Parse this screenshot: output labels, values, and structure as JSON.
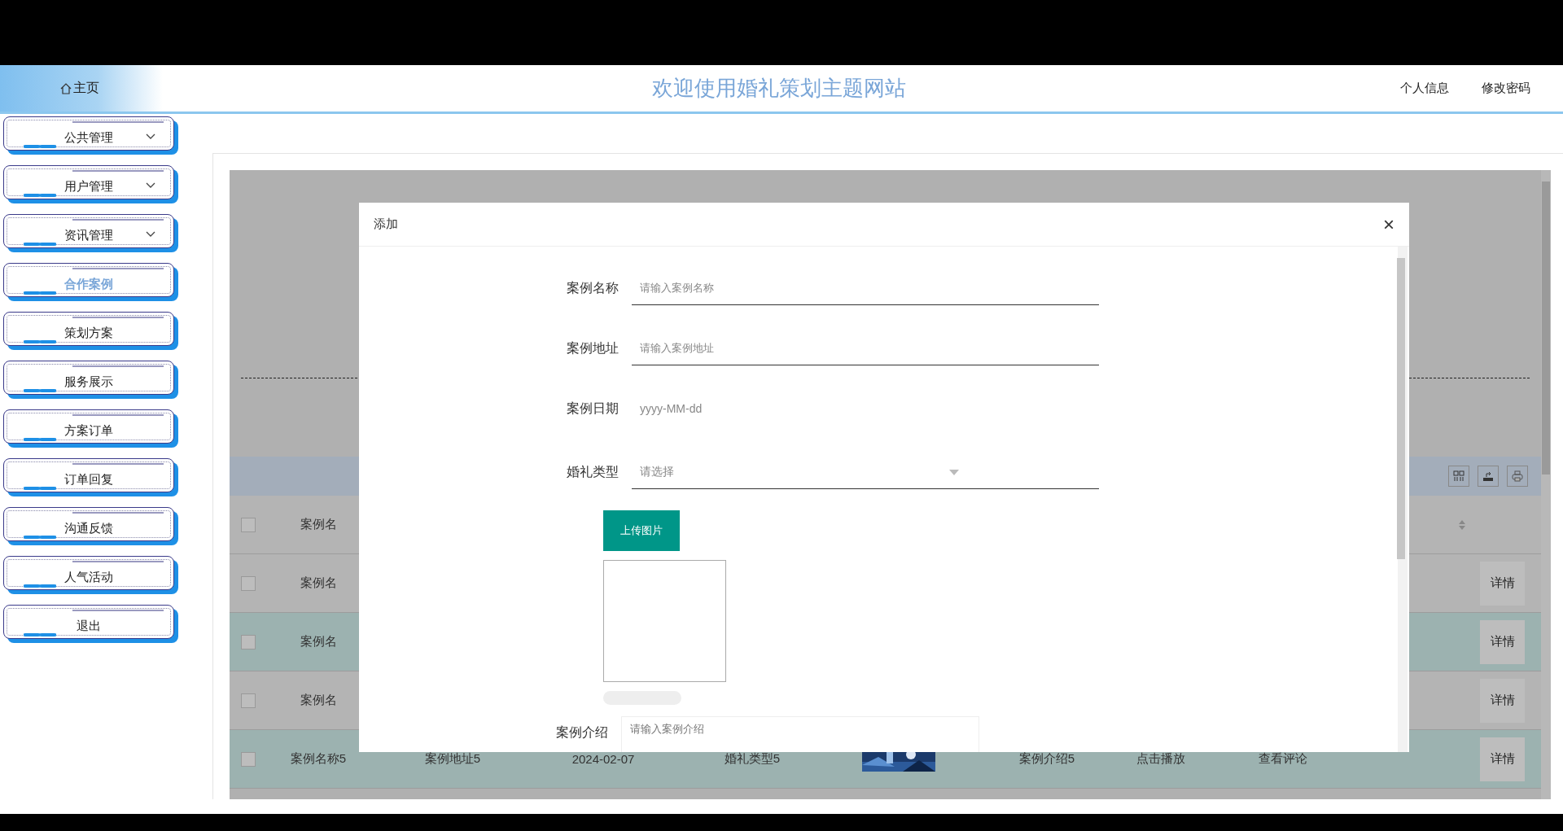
{
  "header": {
    "home": "主页",
    "title": "欢迎使用婚礼策划主题网站",
    "links": [
      "个人信息",
      "修改密码"
    ]
  },
  "sidebar": {
    "items": [
      {
        "label": "公共管理",
        "expandable": true,
        "selected": false
      },
      {
        "label": "用户管理",
        "expandable": true,
        "selected": false
      },
      {
        "label": "资讯管理",
        "expandable": true,
        "selected": false
      },
      {
        "label": "合作案例",
        "expandable": false,
        "selected": true
      },
      {
        "label": "策划方案",
        "expandable": false,
        "selected": false
      },
      {
        "label": "服务展示",
        "expandable": false,
        "selected": false
      },
      {
        "label": "方案订单",
        "expandable": false,
        "selected": false
      },
      {
        "label": "订单回复",
        "expandable": false,
        "selected": false
      },
      {
        "label": "沟通反馈",
        "expandable": false,
        "selected": false
      },
      {
        "label": "人气活动",
        "expandable": false,
        "selected": false
      },
      {
        "label": "退出",
        "expandable": false,
        "selected": false
      }
    ]
  },
  "table": {
    "header": {
      "checked": false,
      "column_1": "案例名"
    },
    "rows": [
      {
        "checked": false,
        "name": "案例名",
        "action": "详情"
      },
      {
        "checked": false,
        "name": "案例名",
        "action": "详情"
      },
      {
        "checked": false,
        "name": "案例名",
        "action": "详情"
      },
      {
        "checked": false,
        "name": "案例名称5",
        "address": "案例地址5",
        "date": "2024-02-07",
        "type": "婚礼类型5",
        "intro": "案例介绍5",
        "video": "点击播放",
        "comments": "查看评论",
        "action": "详情"
      }
    ]
  },
  "dialog": {
    "title": "添加",
    "close": "×",
    "fields": [
      {
        "kind": "text",
        "label": "案例名称",
        "placeholder": "请输入案例名称"
      },
      {
        "kind": "text",
        "label": "案例地址",
        "placeholder": "请输入案例地址"
      },
      {
        "kind": "date",
        "label": "案例日期",
        "placeholder": "yyyy-MM-dd"
      },
      {
        "kind": "select",
        "label": "婚礼类型",
        "placeholder": "请选择"
      },
      {
        "kind": "upload",
        "button": "上传图片",
        "progress": {
          "level": 0
        }
      },
      {
        "kind": "textarea",
        "label": "案例介绍",
        "placeholder": "请输入案例介绍"
      }
    ]
  }
}
